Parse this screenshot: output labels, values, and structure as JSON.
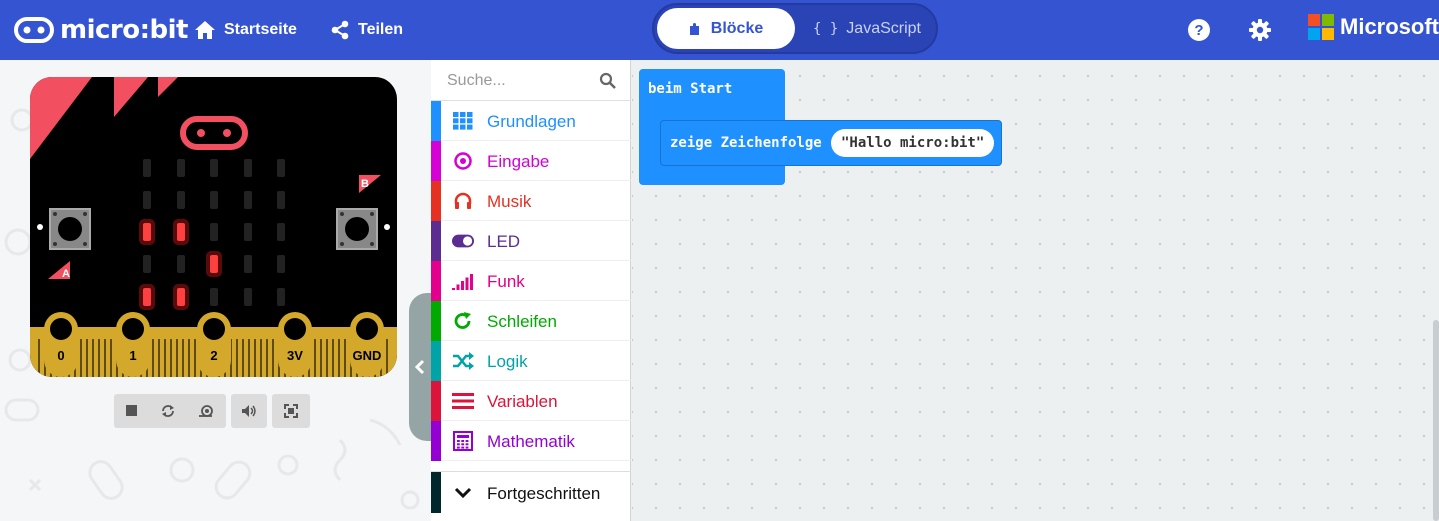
{
  "header": {
    "logo_text": "micro:bit",
    "home_label": "Startseite",
    "share_label": "Teilen",
    "mode_blocks": "Blöcke",
    "mode_javascript": "JavaScript",
    "brand_text": "Microsoft",
    "icons": [
      "microbit-logo-icon",
      "home-icon",
      "share-icon",
      "puzzle-icon",
      "braces-icon",
      "help-icon",
      "gear-icon",
      "microsoft-logo-icon"
    ],
    "colors": {
      "bar": "#3454d1"
    }
  },
  "simulator": {
    "button_a": "A",
    "button_b": "B",
    "pins": [
      "0",
      "1",
      "2",
      "3V",
      "GND"
    ],
    "led_matrix": [
      [
        0,
        0,
        0,
        0,
        0
      ],
      [
        0,
        0,
        0,
        0,
        0
      ],
      [
        1,
        1,
        0,
        0,
        0
      ],
      [
        0,
        0,
        1,
        0,
        0
      ],
      [
        1,
        1,
        0,
        0,
        0
      ]
    ],
    "controls": [
      "stop-icon",
      "restart-icon",
      "slow-motion-icon",
      "sound-icon",
      "fullscreen-icon"
    ]
  },
  "toolbox": {
    "search_placeholder": "Suche...",
    "categories": [
      {
        "label": "Grundlagen",
        "color": "#1e90ff",
        "icon": "grid-icon"
      },
      {
        "label": "Eingabe",
        "color": "#d400d4",
        "icon": "target-icon"
      },
      {
        "label": "Musik",
        "color": "#e63022",
        "icon": "headphones-icon"
      },
      {
        "label": "LED",
        "color": "#5c2d91",
        "icon": "toggle-icon"
      },
      {
        "label": "Funk",
        "color": "#e3008c",
        "icon": "signal-icon"
      },
      {
        "label": "Schleifen",
        "color": "#00aa00",
        "icon": "refresh-icon"
      },
      {
        "label": "Logik",
        "color": "#00a4a6",
        "icon": "shuffle-icon"
      },
      {
        "label": "Variablen",
        "color": "#dc143c",
        "icon": "lines-icon"
      },
      {
        "label": "Mathematik",
        "color": "#9400d3",
        "icon": "calculator-icon"
      }
    ],
    "advanced_label": "Fortgeschritten"
  },
  "workspace": {
    "start_block_label": "beim Start",
    "show_string_label": "zeige Zeichenfolge",
    "string_value": "\"Hallo micro:bit\""
  }
}
